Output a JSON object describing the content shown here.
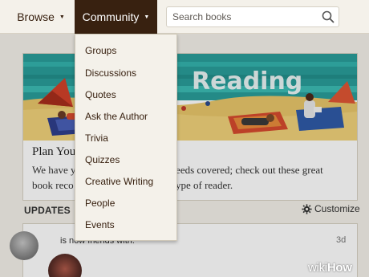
{
  "nav": {
    "browse_label": "Browse",
    "community_label": "Community",
    "caret_icon": "caret-down-icon"
  },
  "search": {
    "placeholder": "Search books",
    "icon": "search-icon"
  },
  "community_menu": {
    "items": [
      {
        "label": "Groups",
        "highlighted": true
      },
      {
        "label": "Discussions"
      },
      {
        "label": "Quotes"
      },
      {
        "label": "Ask the Author"
      },
      {
        "label": "Trivia"
      },
      {
        "label": "Quizzes"
      },
      {
        "label": "Creative Writing"
      },
      {
        "label": "People"
      },
      {
        "label": "Events"
      }
    ],
    "highlight_color": "#22e22a"
  },
  "banner": {
    "image_text": "Reading",
    "title": "Plan You",
    "text_left": "We have y",
    "text_right": "needs covered; check out these great",
    "text_line2_left": "book reco",
    "text_line2_right": "y type of reader."
  },
  "updates": {
    "heading": "UPDATES",
    "customize_label": "Customize",
    "customize_icon": "gear-icon",
    "entry_text": "is now friends with:",
    "entry_time": "3d"
  },
  "watermark": {
    "wiki": "wiki",
    "how": "How"
  },
  "colors": {
    "nav_active_bg": "#382110",
    "page_bg": "#f4f1ea"
  }
}
